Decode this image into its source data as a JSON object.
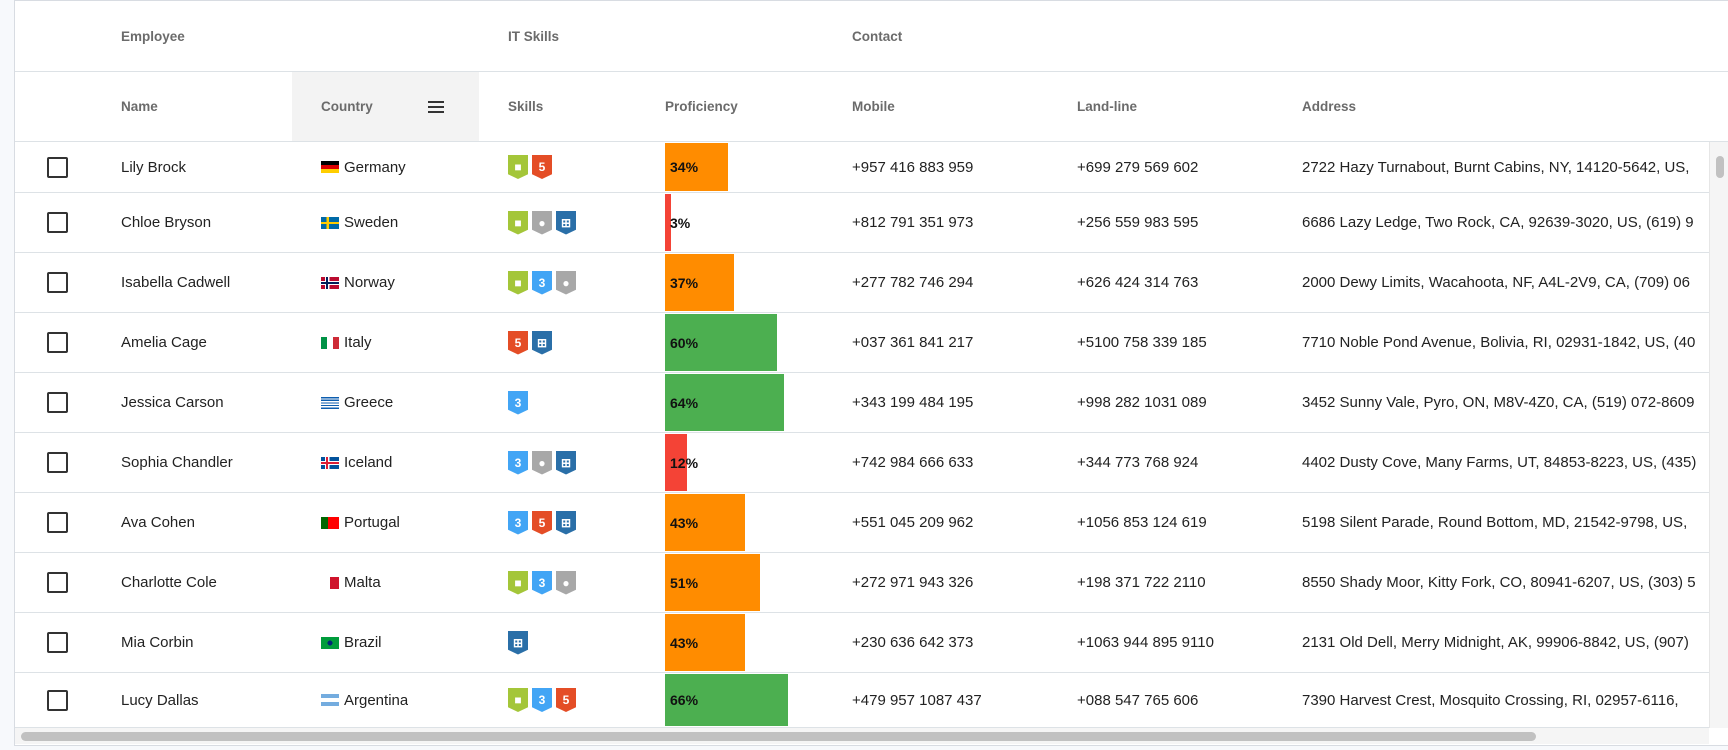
{
  "groups": [
    "Employee",
    "IT Skills",
    "Contact"
  ],
  "columns": {
    "name": "Name",
    "country": "Country",
    "skills": "Skills",
    "proficiency": "Proficiency",
    "mobile": "Mobile",
    "landline": "Land-line",
    "address": "Address"
  },
  "colors": {
    "low": "#f44336",
    "mid": "#ff8c00",
    "high": "#4caf50",
    "android": "#a4c639",
    "html5": "#e44d26",
    "css3": "#42a5f5",
    "mac": "#a8a8a8",
    "windows": "#2a6fa8"
  },
  "rows": [
    {
      "name": "Lily Brock",
      "country": "Germany",
      "flag": "de",
      "skills": [
        "android",
        "html5"
      ],
      "proficiency": 34,
      "proficiency_label": "34%",
      "mobile": "+957 416 883 959",
      "landline": "+699 279 569 602",
      "address": "2722 Hazy Turnabout, Burnt Cabins, NY, 14120-5642, US,"
    },
    {
      "name": "Chloe Bryson",
      "country": "Sweden",
      "flag": "se",
      "skills": [
        "android",
        "mac",
        "windows"
      ],
      "proficiency": 3,
      "proficiency_label": "3%",
      "mobile": "+812 791 351 973",
      "landline": "+256 559 983 595",
      "address": "6686 Lazy Ledge, Two Rock, CA, 92639-3020, US, (619) 9"
    },
    {
      "name": "Isabella Cadwell",
      "country": "Norway",
      "flag": "no",
      "skills": [
        "android",
        "css3",
        "mac"
      ],
      "proficiency": 37,
      "proficiency_label": "37%",
      "mobile": "+277 782 746 294",
      "landline": "+626 424 314 763",
      "address": "2000 Dewy Limits, Wacahoota, NF, A4L-2V9, CA, (709) 06"
    },
    {
      "name": "Amelia Cage",
      "country": "Italy",
      "flag": "it",
      "skills": [
        "html5",
        "windows"
      ],
      "proficiency": 60,
      "proficiency_label": "60%",
      "mobile": "+037 361 841 217",
      "landline": "+5100 758 339 185",
      "address": "7710 Noble Pond Avenue, Bolivia, RI, 02931-1842, US, (40"
    },
    {
      "name": "Jessica Carson",
      "country": "Greece",
      "flag": "gr",
      "skills": [
        "css3"
      ],
      "proficiency": 64,
      "proficiency_label": "64%",
      "mobile": "+343 199 484 195",
      "landline": "+998 282 1031 089",
      "address": "3452 Sunny Vale, Pyro, ON, M8V-4Z0, CA, (519) 072-8609"
    },
    {
      "name": "Sophia Chandler",
      "country": "Iceland",
      "flag": "is",
      "skills": [
        "css3",
        "mac",
        "windows"
      ],
      "proficiency": 12,
      "proficiency_label": "12%",
      "mobile": "+742 984 666 633",
      "landline": "+344 773 768 924",
      "address": "4402 Dusty Cove, Many Farms, UT, 84853-8223, US, (435)"
    },
    {
      "name": "Ava Cohen",
      "country": "Portugal",
      "flag": "pt",
      "skills": [
        "css3",
        "html5",
        "windows"
      ],
      "proficiency": 43,
      "proficiency_label": "43%",
      "mobile": "+551 045 209 962",
      "landline": "+1056 853 124 619",
      "address": "5198 Silent Parade, Round Bottom, MD, 21542-9798, US,"
    },
    {
      "name": "Charlotte Cole",
      "country": "Malta",
      "flag": "mt",
      "skills": [
        "android",
        "css3",
        "mac"
      ],
      "proficiency": 51,
      "proficiency_label": "51%",
      "mobile": "+272 971 943 326",
      "landline": "+198 371 722 2110",
      "address": "8550 Shady Moor, Kitty Fork, CO, 80941-6207, US, (303) 5"
    },
    {
      "name": "Mia Corbin",
      "country": "Brazil",
      "flag": "br",
      "skills": [
        "windows"
      ],
      "proficiency": 43,
      "proficiency_label": "43%",
      "mobile": "+230 636 642 373",
      "landline": "+1063 944 895 9110",
      "address": "2131 Old Dell, Merry Midnight, AK, 99906-8842, US, (907)"
    },
    {
      "name": "Lucy Dallas",
      "country": "Argentina",
      "flag": "ar",
      "skills": [
        "android",
        "css3",
        "html5"
      ],
      "proficiency": 66,
      "proficiency_label": "66%",
      "mobile": "+479 957 1087 437",
      "landline": "+088 547 765 606",
      "address": "7390 Harvest Crest, Mosquito Crossing, RI, 02957-6116,"
    }
  ]
}
